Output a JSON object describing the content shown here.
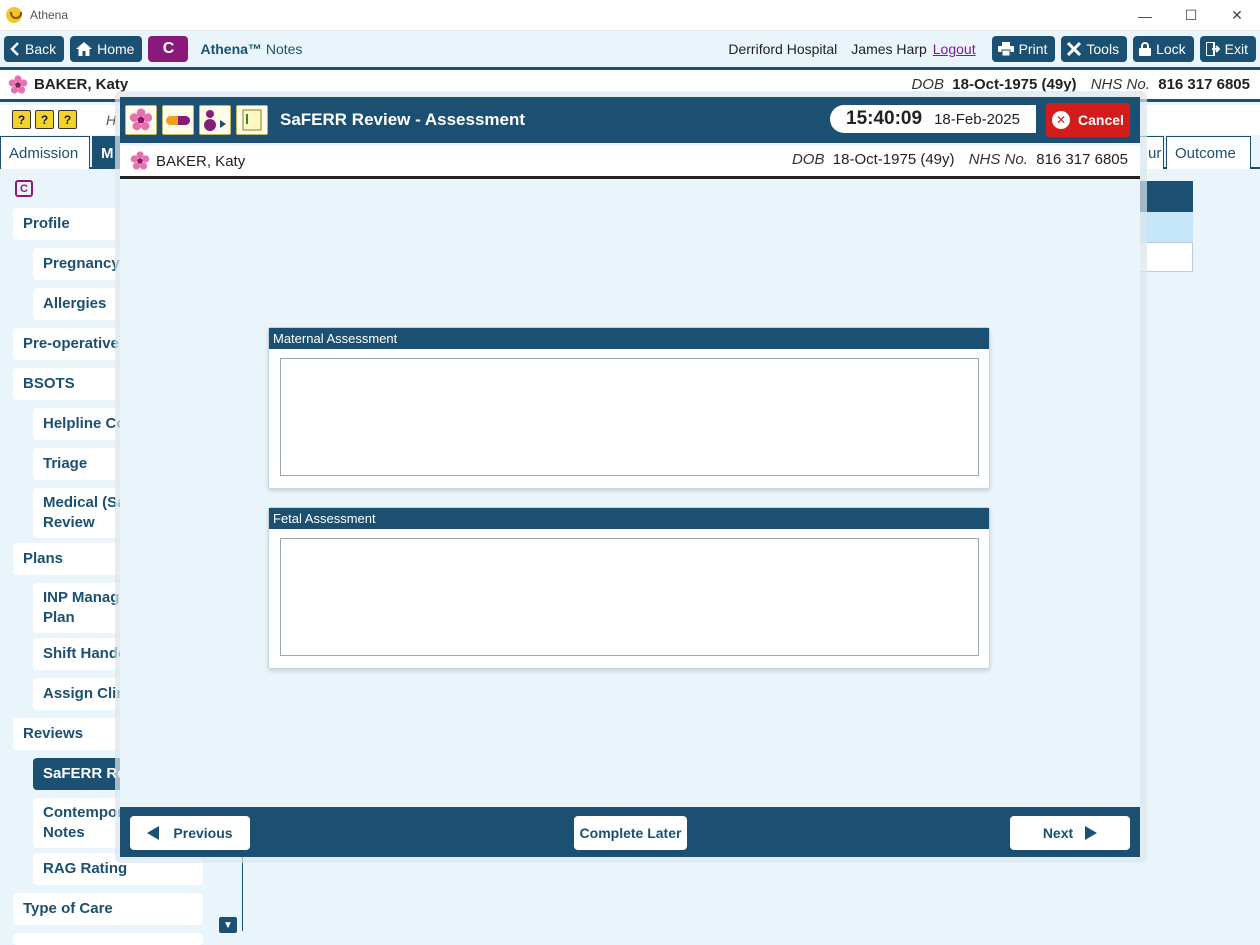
{
  "window": {
    "title": "Athena",
    "minimize": "—",
    "maximize": "☐",
    "close": "✕"
  },
  "toolbar": {
    "back": "Back",
    "home": "Home",
    "c_button": "C",
    "brand_bold": "Athena™",
    "brand_rest": "Notes",
    "hospital": "Derriford Hospital",
    "user": "James Harp",
    "logout": "Logout",
    "print": "Print",
    "tools": "Tools",
    "lock": "Lock",
    "exit": "Exit"
  },
  "patient": {
    "name": "BAKER, Katy",
    "dob_label": "DOB",
    "dob": "18-Oct-1975 (49y)",
    "nhs_label": "NHS No.",
    "nhs": "816 317 6805"
  },
  "background": {
    "bar2_letter": "H",
    "tabs": {
      "admission": "Admission",
      "active_partial": "M",
      "partial_ur": "ur",
      "outcome": "Outcome"
    },
    "c_badge": "C",
    "nav": {
      "profile": "Profile",
      "pregnancy": "Pregnancy",
      "allergies": "Allergies",
      "preoperative": "Pre-operative",
      "bsots": "BSOTS",
      "helpline": "Helpline Co",
      "triage": "Triage",
      "medical_1": "Medical (Sa",
      "medical_2": "Review",
      "plans": "Plans",
      "inp_1": "INP Manag",
      "inp_2": "Plan",
      "shift": "Shift Hando",
      "assign": "Assign Clin",
      "reviews": "Reviews",
      "saferr": "SaFERR Rev",
      "contemp_1": "Contempor",
      "contemp_2": "Notes",
      "rag": "RAG Rating",
      "typeofcare": "Type of Care"
    }
  },
  "modal": {
    "title": "SaFERR Review - Assessment",
    "time": "15:40:09",
    "date": "18-Feb-2025",
    "cancel": "Cancel",
    "maternal_title": "Maternal Assessment",
    "maternal_value": "",
    "fetal_title": "Fetal Assessment",
    "fetal_value": "",
    "previous": "Previous",
    "complete_later": "Complete Later",
    "next": "Next"
  },
  "colors": {
    "navy": "#1c5072",
    "purple": "#8a1a7a",
    "cancel_red": "#d41c1c",
    "bg": "#eaf5fb"
  }
}
